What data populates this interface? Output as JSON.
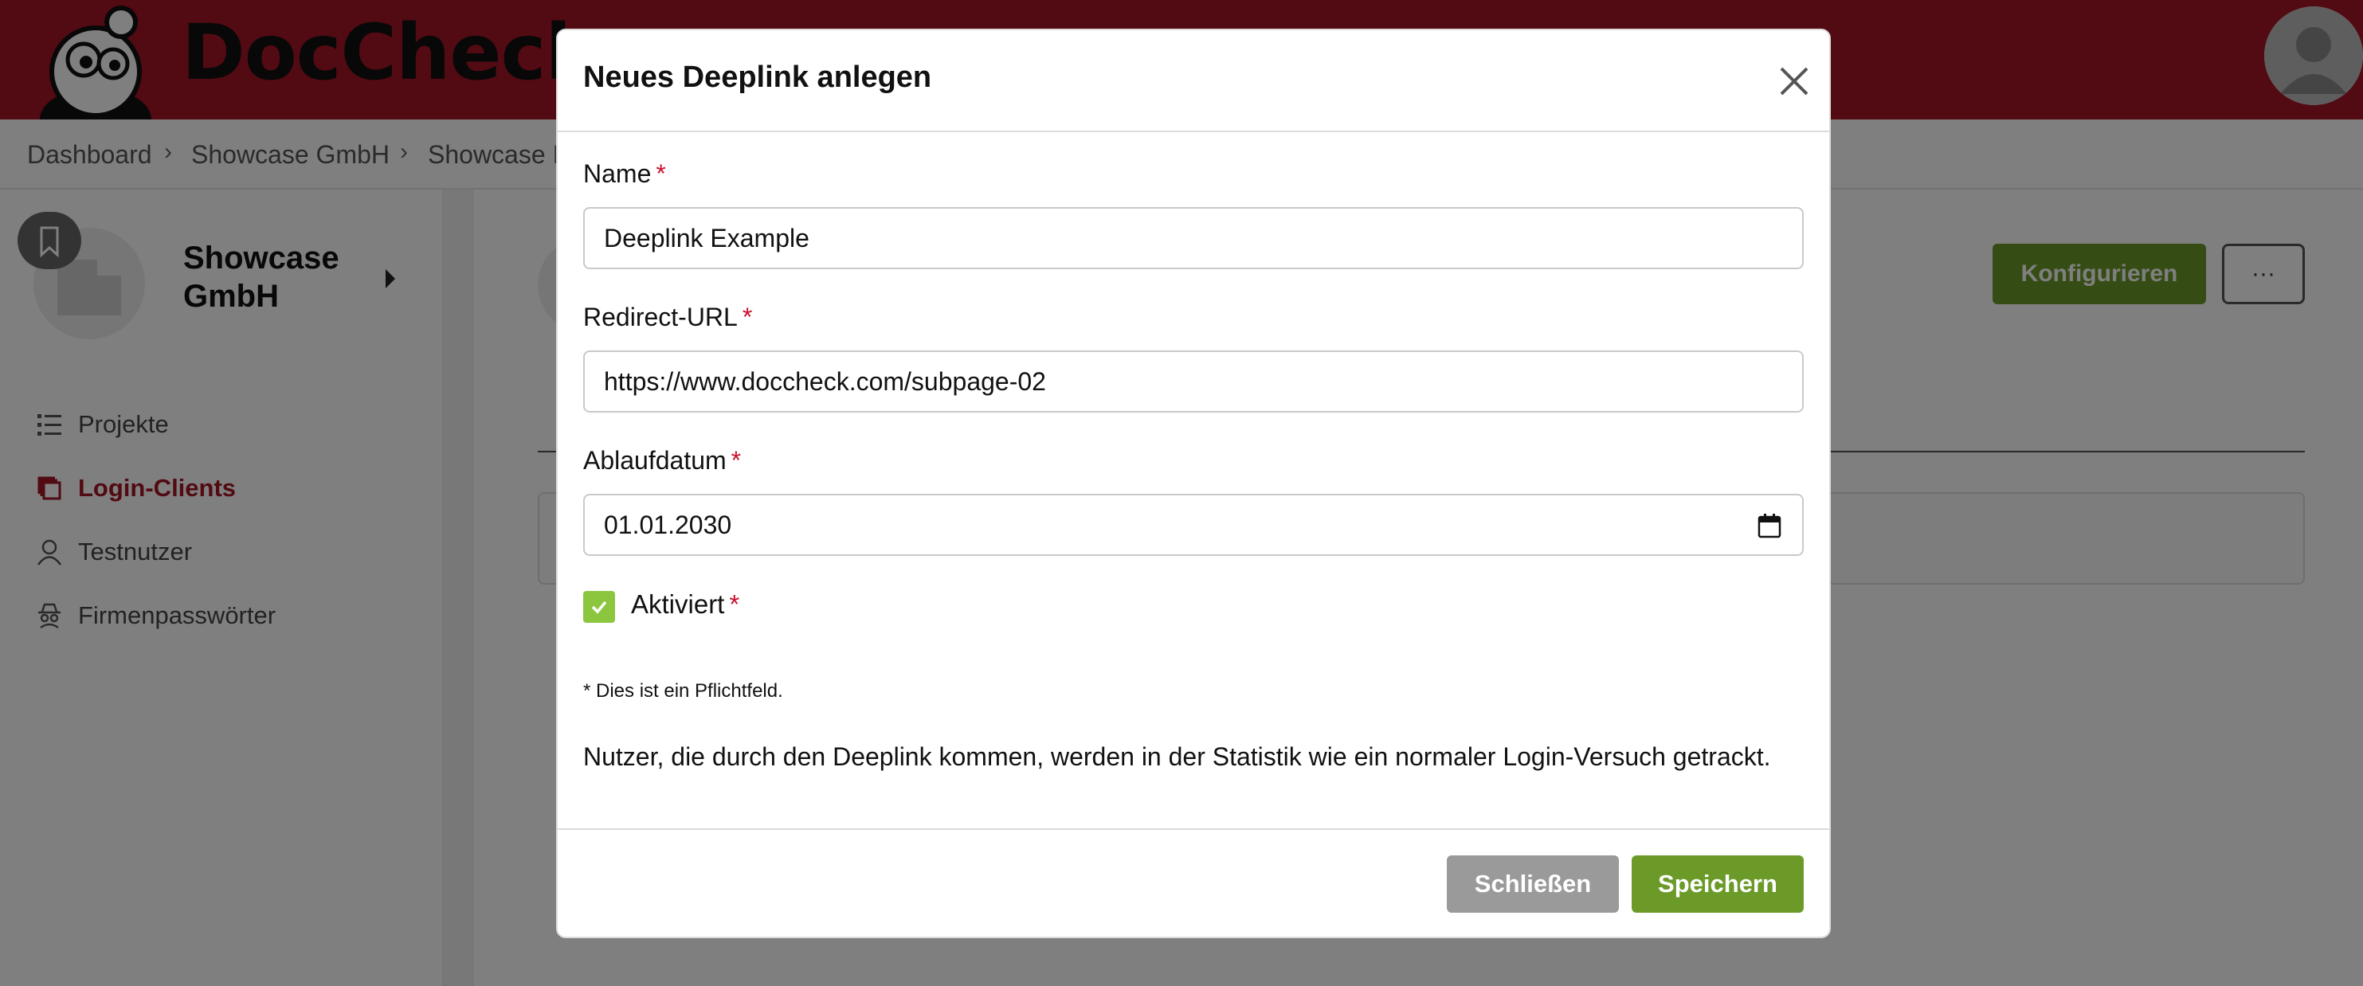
{
  "app": {
    "logo_text": "DocCheck",
    "brand_color": "#a51426",
    "accent_green": "#6b9a29"
  },
  "breadcrumb": [
    {
      "label": "Dashboard"
    },
    {
      "label": "Showcase GmbH"
    },
    {
      "label": "Showcase I"
    }
  ],
  "sidebar": {
    "company_name": "Showcase GmbH",
    "items": [
      {
        "label": "Projekte",
        "icon": "list-icon",
        "active": false
      },
      {
        "label": "Login-Clients",
        "icon": "copy-icon",
        "active": true
      },
      {
        "label": "Testnutzer",
        "icon": "user-icon",
        "active": false
      },
      {
        "label": "Firmenpasswörter",
        "icon": "spy-icon",
        "active": false
      }
    ]
  },
  "main": {
    "configure_label": "Konfigurieren",
    "more_label": "···"
  },
  "modal": {
    "title": "Neues Deeplink anlegen",
    "fields": {
      "name": {
        "label": "Name",
        "required_mark": "*",
        "value": "Deeplink Example"
      },
      "redirect_url": {
        "label": "Redirect-URL",
        "required_mark": "*",
        "value": "https://www.doccheck.com/subpage-02"
      },
      "expiry": {
        "label": "Ablaufdatum",
        "required_mark": "*",
        "value": "01.01.2030"
      },
      "activated": {
        "label": "Aktiviert",
        "required_mark": "*",
        "checked": true
      }
    },
    "required_hint": "* Dies ist ein Pflichtfeld.",
    "info_text": "Nutzer, die durch den Deeplink kommen, werden in der Statistik wie ein normaler Login-Versuch getrackt.",
    "close_label": "Schließen",
    "save_label": "Speichern"
  }
}
